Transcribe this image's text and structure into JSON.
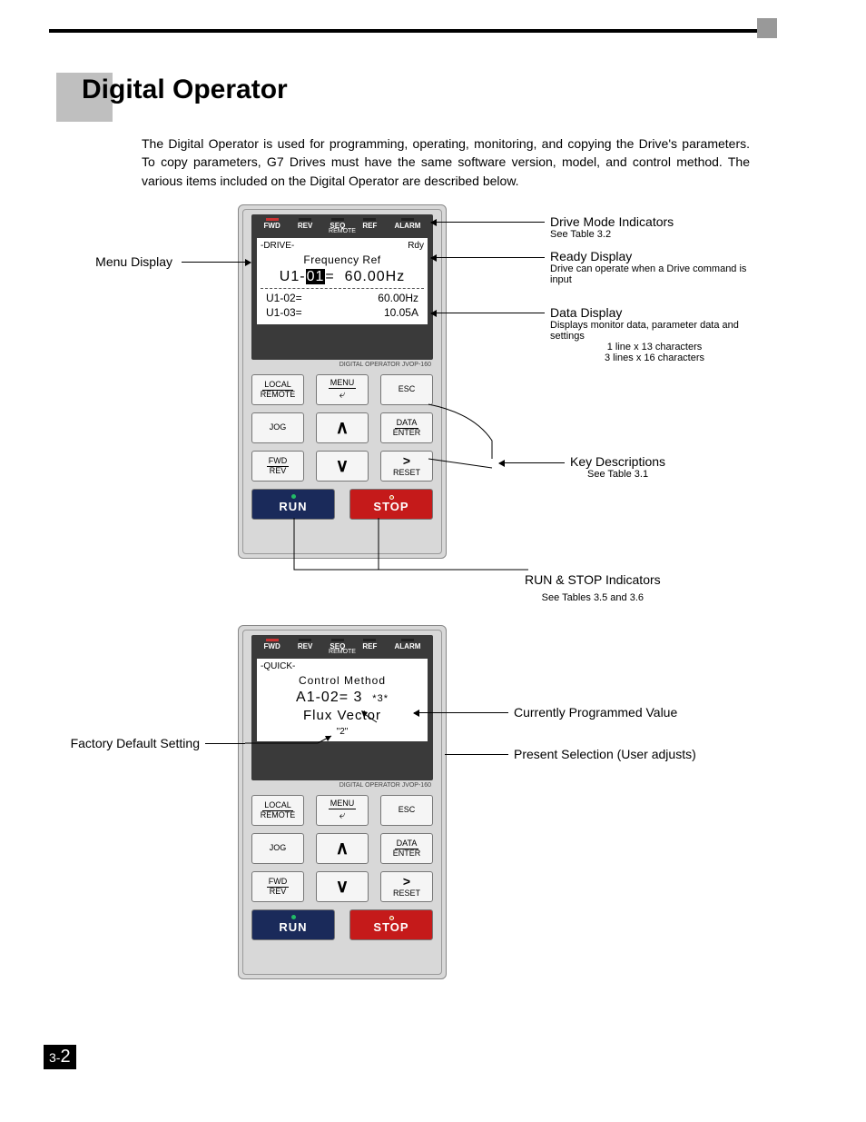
{
  "page": {
    "section_prefix": "3-",
    "section_big": "2"
  },
  "heading": "Digital Operator",
  "intro": "The Digital Operator is used for programming, operating, monitoring, and copying the Drive's parameters. To copy parameters, G7 Drives must have the same software version, model, and control method. The various items included on the Digital Operator are described below.",
  "indicators": {
    "fwd": "FWD",
    "rev": "REV",
    "seq": "SEQ",
    "ref": "REF",
    "alarm": "ALARM",
    "remote": "REMOTE"
  },
  "operator_label": "DIGITAL OPERATOR JVOP-160",
  "panel1": {
    "mode": "-DRIVE-",
    "rdy": "Rdy",
    "title": "Frequency Ref",
    "main_pre": "U1-",
    "main_cursor": "01",
    "main_post": "=",
    "main_val": "60.00Hz",
    "sub1_l": "U1-02=",
    "sub1_r": "60.00Hz",
    "sub2_l": "U1-03=",
    "sub2_r": "10.05A"
  },
  "panel2": {
    "mode": "-QUICK-",
    "title": "Control Method",
    "param": "A1-02= 3",
    "star": "*3*",
    "flux": "Flux Vector",
    "default": "\"2\""
  },
  "keys": {
    "local": "LOCAL",
    "remote": "REMOTE",
    "menu": "MENU",
    "esc": "ESC",
    "jog": "JOG",
    "data": "DATA",
    "enter": "ENTER",
    "fwd": "FWD",
    "rev": "REV",
    "reset": "RESET",
    "run": "RUN",
    "stop": "STOP"
  },
  "callouts": {
    "menu_display": "Menu Display",
    "drive_mode": "Drive Mode Indicators",
    "drive_mode_sub": "See Table 3.2",
    "ready": "Ready Display",
    "ready_sub": "Drive can operate when a Drive command is input",
    "data_display": "Data Display",
    "data_display_sub1": "Displays monitor data, parameter data and settings",
    "data_display_sub2": "1 line x 13 characters",
    "data_display_sub3": "3 lines x 16 characters",
    "key_desc": "Key Descriptions",
    "key_desc_sub": "See Table 3.1",
    "run_stop": "RUN & STOP Indicators",
    "run_stop_sub": "See Tables 3.5 and 3.6",
    "factory_default": "Factory Default Setting",
    "current_prog": "Currently Programmed Value",
    "present_sel": "Present Selection (User adjusts)"
  }
}
